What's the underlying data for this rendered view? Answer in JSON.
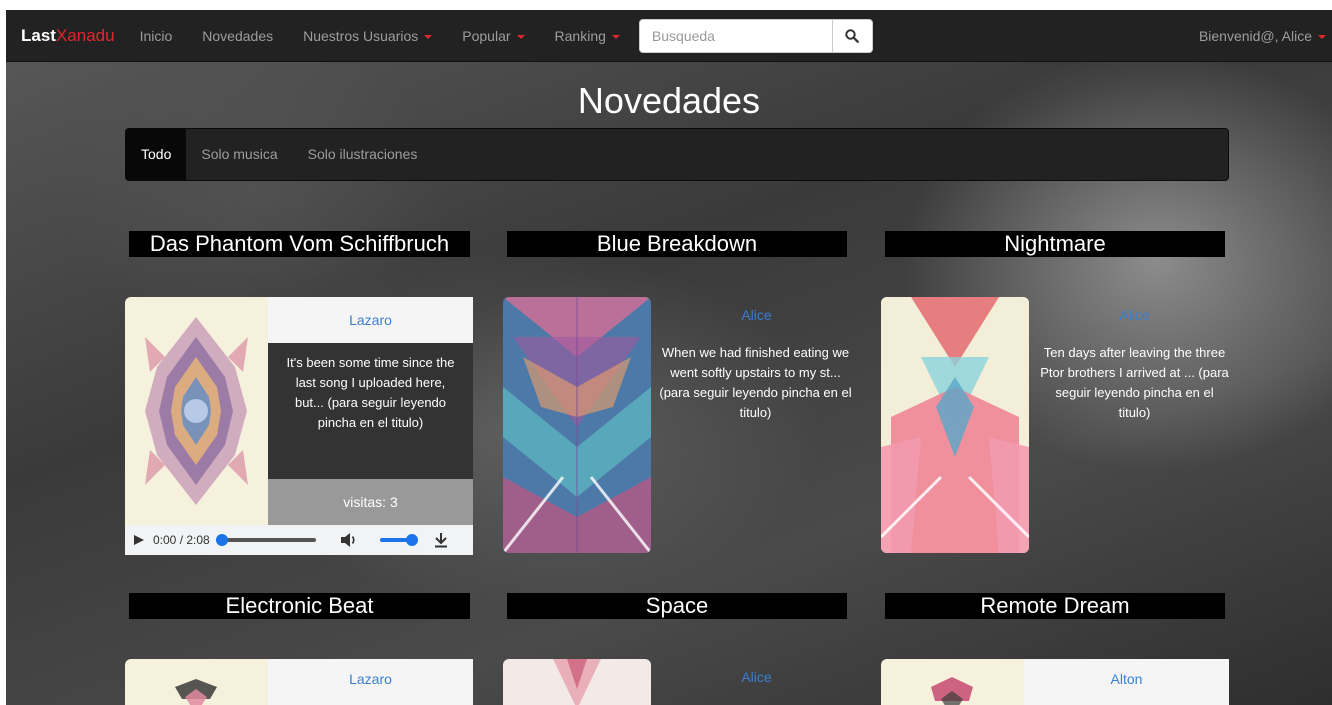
{
  "navbar": {
    "brand_part1": "Last",
    "brand_part2": "Xanadu",
    "items": [
      {
        "label": "Inicio"
      },
      {
        "label": "Novedades"
      },
      {
        "label": "Nuestros Usuarios"
      },
      {
        "label": "Popular"
      },
      {
        "label": "Ranking"
      }
    ],
    "search_placeholder": "Busqueda",
    "user_label": "Bienvenid@, Alice"
  },
  "page_title": "Novedades",
  "subnav": [
    {
      "label": "Todo"
    },
    {
      "label": "Solo musica"
    },
    {
      "label": "Solo ilustraciones"
    }
  ],
  "cards": [
    {
      "title": "Das Phantom Vom Schiffbruch",
      "author": "Lazaro",
      "description": "It's been some time since the last song I uploaded here, but... (para seguir leyendo pincha en el titulo)",
      "visits": "visitas: 3",
      "player": {
        "time": "0:00 / 2:08"
      }
    },
    {
      "title": "Blue Breakdown",
      "author": "Alice",
      "description": "When we had finished eating we went softly upstairs to my st... (para seguir leyendo pincha en el titulo)"
    },
    {
      "title": "Nightmare",
      "author": "Alice",
      "description": "Ten days after leaving the three Ptor brothers I arrived at ... (para seguir leyendo pincha en el titulo)"
    },
    {
      "title": "Electronic Beat",
      "author": "Lazaro"
    },
    {
      "title": "Space",
      "author": "Alice"
    },
    {
      "title": "Remote Dream",
      "author": "Alton"
    }
  ],
  "colors": {
    "accent": "#e0262f",
    "link": "#3b7fd0",
    "navbar": "#222222"
  }
}
